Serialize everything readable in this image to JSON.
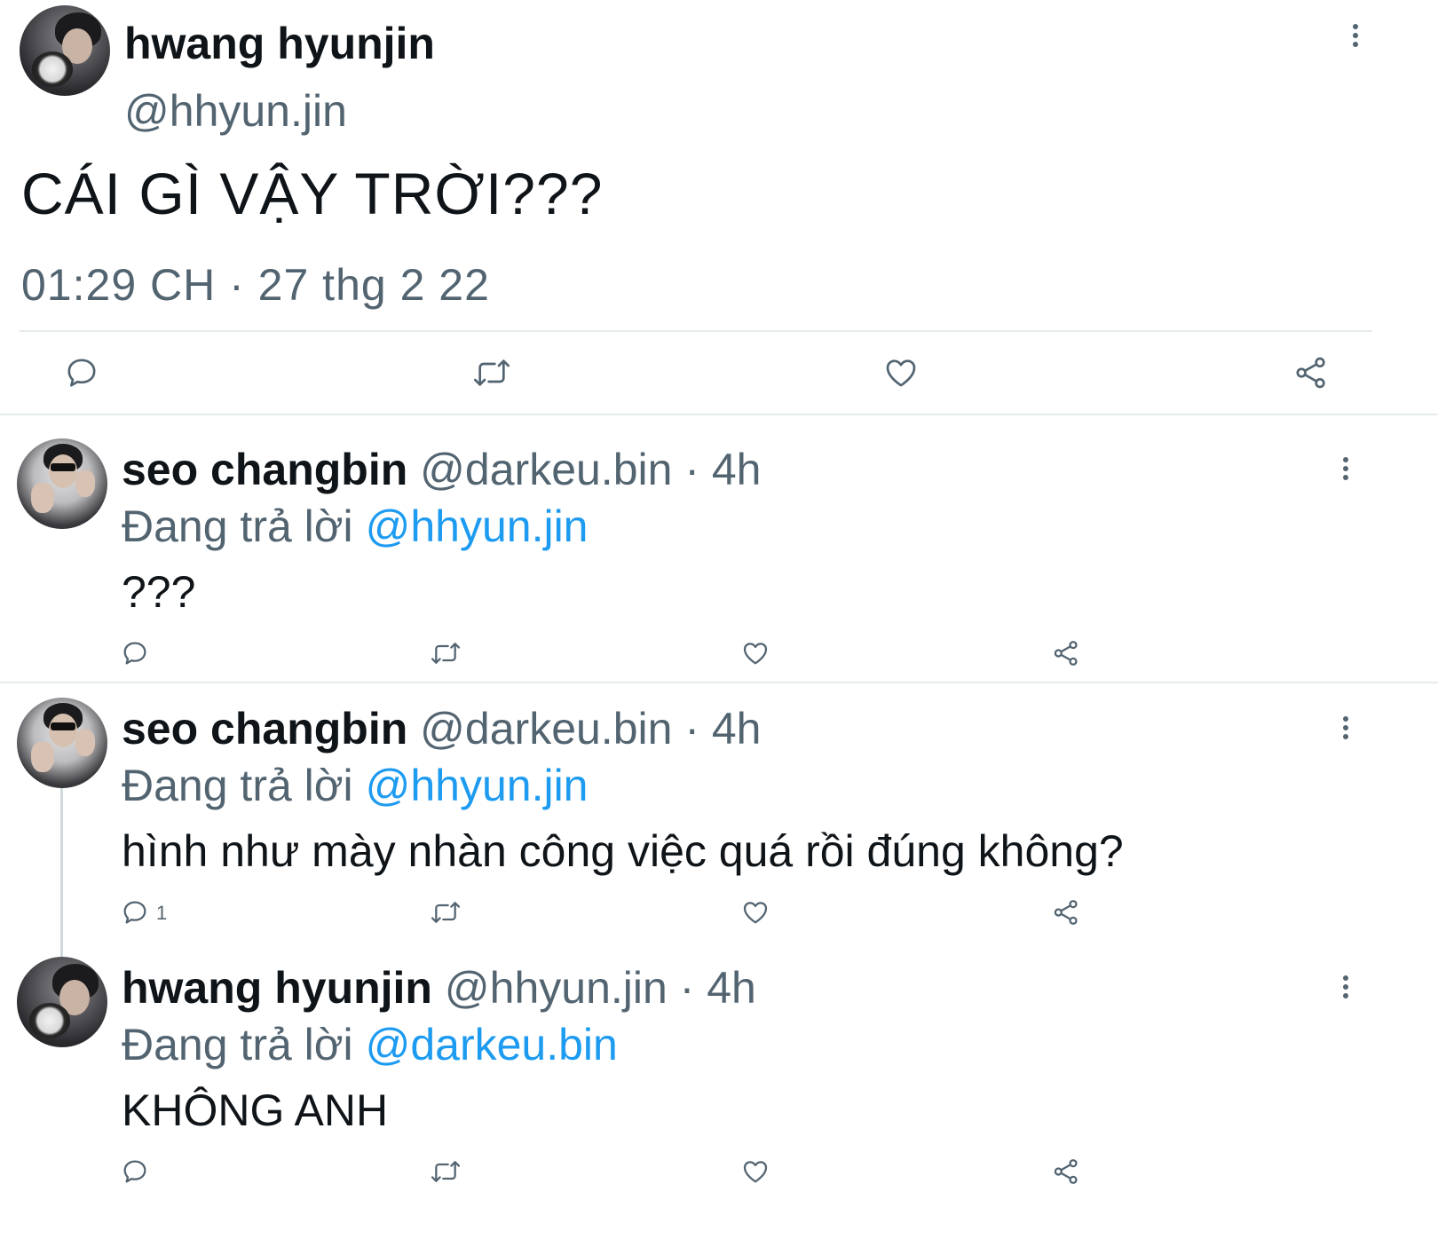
{
  "main_tweet": {
    "author_name": "hwang hyunjin",
    "author_handle": "@hhyun.jin",
    "text": "CÁI GÌ VẬY TRỜI???",
    "timestamp": "01:29 CH · 27 thg 2 22",
    "icons": {
      "reply": "reply-icon",
      "retweet": "retweet-icon",
      "like": "like-icon",
      "share": "share-icon",
      "more": "more-vertical-icon"
    }
  },
  "replies": [
    {
      "author_name": "seo changbin",
      "meta": "@darkeu.bin · 4h",
      "replying_label": "Đang trả lời",
      "replying_to": "@hhyun.jin",
      "text": "???",
      "reply_count": ""
    },
    {
      "author_name": "seo changbin",
      "meta": "@darkeu.bin · 4h",
      "replying_label": "Đang trả lời",
      "replying_to": "@hhyun.jin",
      "text": "hình như mày nhàn công việc quá rồi đúng không?",
      "reply_count": "1"
    },
    {
      "author_name": "hwang hyunjin",
      "meta": "@hhyun.jin · 4h",
      "replying_label": "Đang trả lời",
      "replying_to": "@darkeu.bin",
      "text": "KHÔNG ANH",
      "reply_count": ""
    }
  ],
  "colors": {
    "text_primary": "#0f1419",
    "text_secondary": "#536471",
    "link": "#1d9bf0",
    "divider": "#e6ebee"
  }
}
